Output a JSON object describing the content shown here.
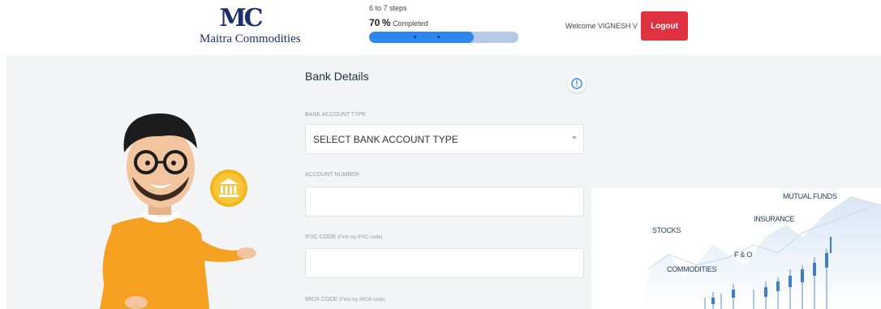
{
  "header": {
    "logo_mark": "MC",
    "logo_text": "Maitra Commodities",
    "steps": "6 to 7 steps",
    "percent_value": "70",
    "percent_suffix": "%",
    "completed_label": "Completed",
    "progress_fraction": 0.7,
    "welcome": "Welcome VIGNESH V",
    "logout_label": "Logout"
  },
  "form": {
    "title": "Bank Details",
    "bank_account_type_label": "BANK ACCOUNT TYPE",
    "bank_account_type_value": "SELECT BANK ACCOUNT TYPE",
    "account_number_label": "ACCOUNT NUMBER",
    "account_number_value": "",
    "ifsc_label": "IFSC CODE",
    "ifsc_hint": "(Find my IFSC code)",
    "ifsc_value": "",
    "micr_label": "MICR CODE",
    "micr_hint": "(Find my MICR code)"
  },
  "finance_image": {
    "labels": [
      "MUTUAL FUNDS",
      "INSURANCE",
      "STOCKS",
      "F & O",
      "COMMODITIES"
    ]
  },
  "colors": {
    "brand": "#1d2f6b",
    "progress_fill": "#2e86f0",
    "progress_track": "#b7c9e8",
    "logout": "#e03141",
    "info_icon": "#2e86f0"
  },
  "icons": [
    "info-icon",
    "bank-icon",
    "chevron-down-icon"
  ]
}
